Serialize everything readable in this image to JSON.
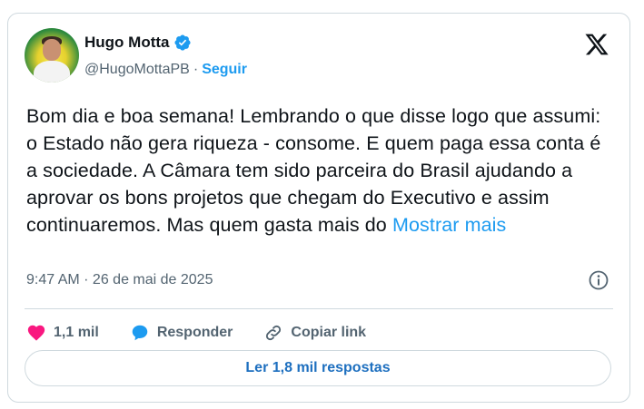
{
  "author": {
    "name": "Hugo Motta",
    "handle": "@HugoMottaPB",
    "separator": "·",
    "follow_label": "Seguir"
  },
  "tweet": {
    "text": "Bom dia e boa semana! Lembrando o que disse logo que assumi: o Estado não gera riqueza - consome. E quem paga essa conta é a sociedade. A Câmara tem sido parceira do Brasil ajudando a aprovar os bons projetos que chegam do Executivo e assim continuaremos. Mas quem gasta mais do",
    "show_more_label": "Mostrar mais",
    "timestamp": "9:47 AM · 26 de mai de 2025"
  },
  "actions": {
    "likes_count": "1,1 mil",
    "reply_label": "Responder",
    "copy_link_label": "Copiar link"
  },
  "read_replies_label": "Ler 1,8 mil respostas",
  "colors": {
    "accent": "#1d9bf0",
    "like": "#f91880",
    "text_secondary": "#536471",
    "border": "#cfd9de"
  },
  "icons": [
    "verified-badge-icon",
    "x-logo-icon",
    "info-icon",
    "heart-icon",
    "reply-bubble-icon",
    "link-icon"
  ]
}
